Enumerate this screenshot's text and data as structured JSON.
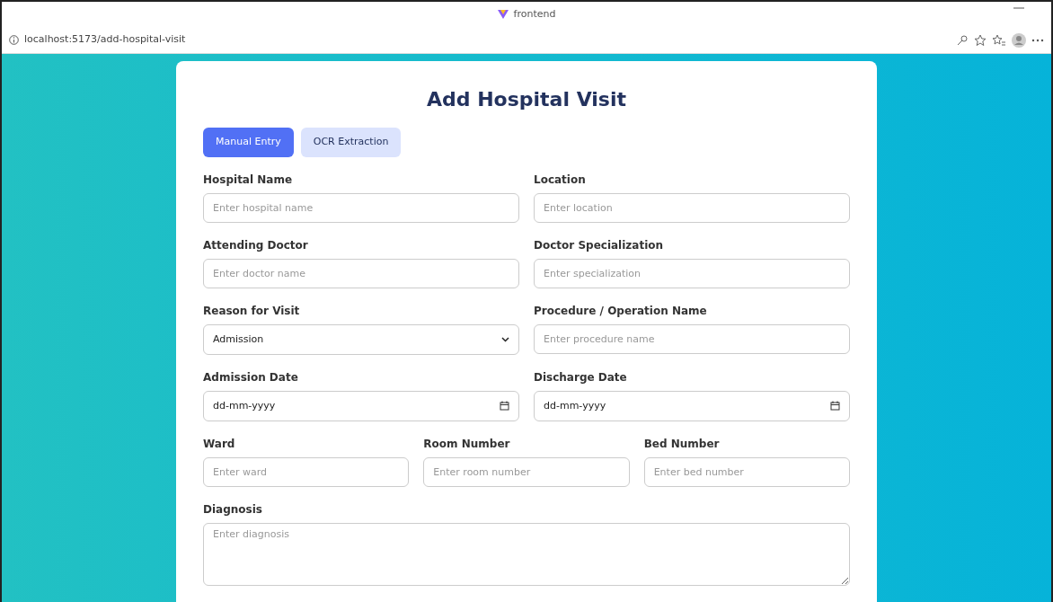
{
  "browser": {
    "tab_title": "frontend",
    "url": "localhost:5173/add-hospital-visit"
  },
  "form": {
    "title": "Add Hospital Visit",
    "tabs": [
      {
        "label": "Manual Entry",
        "selected": true
      },
      {
        "label": "OCR Extraction",
        "selected": false
      }
    ],
    "rows": [
      [
        {
          "kind": "text",
          "label": "Hospital Name",
          "placeholder": "Enter hospital name"
        },
        {
          "kind": "text",
          "label": "Location",
          "placeholder": "Enter location"
        }
      ],
      [
        {
          "kind": "text",
          "label": "Attending Doctor",
          "placeholder": "Enter doctor name"
        },
        {
          "kind": "text",
          "label": "Doctor Specialization",
          "placeholder": "Enter specialization"
        }
      ],
      [
        {
          "kind": "select",
          "label": "Reason for Visit",
          "value": "Admission"
        },
        {
          "kind": "text",
          "label": "Procedure / Operation Name",
          "placeholder": "Enter procedure name"
        }
      ],
      [
        {
          "kind": "date",
          "label": "Admission Date",
          "placeholder": "dd-mm-yyyy"
        },
        {
          "kind": "date",
          "label": "Discharge Date",
          "placeholder": "dd-mm-yyyy"
        }
      ],
      [
        {
          "kind": "text",
          "label": "Ward",
          "placeholder": "Enter ward"
        },
        {
          "kind": "text",
          "label": "Room Number",
          "placeholder": "Enter room number"
        },
        {
          "kind": "text",
          "label": "Bed Number",
          "placeholder": "Enter bed number"
        }
      ],
      [
        {
          "kind": "textarea",
          "label": "Diagnosis",
          "placeholder": "Enter diagnosis"
        }
      ]
    ]
  }
}
